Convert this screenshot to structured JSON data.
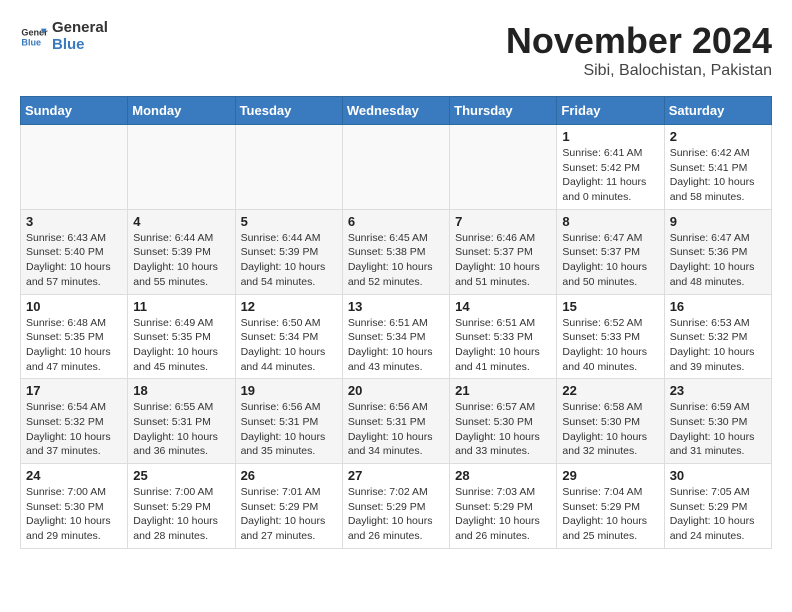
{
  "header": {
    "logo_general": "General",
    "logo_blue": "Blue",
    "month_title": "November 2024",
    "subtitle": "Sibi, Balochistan, Pakistan"
  },
  "weekdays": [
    "Sunday",
    "Monday",
    "Tuesday",
    "Wednesday",
    "Thursday",
    "Friday",
    "Saturday"
  ],
  "weeks": [
    [
      {
        "day": "",
        "info": ""
      },
      {
        "day": "",
        "info": ""
      },
      {
        "day": "",
        "info": ""
      },
      {
        "day": "",
        "info": ""
      },
      {
        "day": "",
        "info": ""
      },
      {
        "day": "1",
        "info": "Sunrise: 6:41 AM\nSunset: 5:42 PM\nDaylight: 11 hours and 0 minutes."
      },
      {
        "day": "2",
        "info": "Sunrise: 6:42 AM\nSunset: 5:41 PM\nDaylight: 10 hours and 58 minutes."
      }
    ],
    [
      {
        "day": "3",
        "info": "Sunrise: 6:43 AM\nSunset: 5:40 PM\nDaylight: 10 hours and 57 minutes."
      },
      {
        "day": "4",
        "info": "Sunrise: 6:44 AM\nSunset: 5:39 PM\nDaylight: 10 hours and 55 minutes."
      },
      {
        "day": "5",
        "info": "Sunrise: 6:44 AM\nSunset: 5:39 PM\nDaylight: 10 hours and 54 minutes."
      },
      {
        "day": "6",
        "info": "Sunrise: 6:45 AM\nSunset: 5:38 PM\nDaylight: 10 hours and 52 minutes."
      },
      {
        "day": "7",
        "info": "Sunrise: 6:46 AM\nSunset: 5:37 PM\nDaylight: 10 hours and 51 minutes."
      },
      {
        "day": "8",
        "info": "Sunrise: 6:47 AM\nSunset: 5:37 PM\nDaylight: 10 hours and 50 minutes."
      },
      {
        "day": "9",
        "info": "Sunrise: 6:47 AM\nSunset: 5:36 PM\nDaylight: 10 hours and 48 minutes."
      }
    ],
    [
      {
        "day": "10",
        "info": "Sunrise: 6:48 AM\nSunset: 5:35 PM\nDaylight: 10 hours and 47 minutes."
      },
      {
        "day": "11",
        "info": "Sunrise: 6:49 AM\nSunset: 5:35 PM\nDaylight: 10 hours and 45 minutes."
      },
      {
        "day": "12",
        "info": "Sunrise: 6:50 AM\nSunset: 5:34 PM\nDaylight: 10 hours and 44 minutes."
      },
      {
        "day": "13",
        "info": "Sunrise: 6:51 AM\nSunset: 5:34 PM\nDaylight: 10 hours and 43 minutes."
      },
      {
        "day": "14",
        "info": "Sunrise: 6:51 AM\nSunset: 5:33 PM\nDaylight: 10 hours and 41 minutes."
      },
      {
        "day": "15",
        "info": "Sunrise: 6:52 AM\nSunset: 5:33 PM\nDaylight: 10 hours and 40 minutes."
      },
      {
        "day": "16",
        "info": "Sunrise: 6:53 AM\nSunset: 5:32 PM\nDaylight: 10 hours and 39 minutes."
      }
    ],
    [
      {
        "day": "17",
        "info": "Sunrise: 6:54 AM\nSunset: 5:32 PM\nDaylight: 10 hours and 37 minutes."
      },
      {
        "day": "18",
        "info": "Sunrise: 6:55 AM\nSunset: 5:31 PM\nDaylight: 10 hours and 36 minutes."
      },
      {
        "day": "19",
        "info": "Sunrise: 6:56 AM\nSunset: 5:31 PM\nDaylight: 10 hours and 35 minutes."
      },
      {
        "day": "20",
        "info": "Sunrise: 6:56 AM\nSunset: 5:31 PM\nDaylight: 10 hours and 34 minutes."
      },
      {
        "day": "21",
        "info": "Sunrise: 6:57 AM\nSunset: 5:30 PM\nDaylight: 10 hours and 33 minutes."
      },
      {
        "day": "22",
        "info": "Sunrise: 6:58 AM\nSunset: 5:30 PM\nDaylight: 10 hours and 32 minutes."
      },
      {
        "day": "23",
        "info": "Sunrise: 6:59 AM\nSunset: 5:30 PM\nDaylight: 10 hours and 31 minutes."
      }
    ],
    [
      {
        "day": "24",
        "info": "Sunrise: 7:00 AM\nSunset: 5:30 PM\nDaylight: 10 hours and 29 minutes."
      },
      {
        "day": "25",
        "info": "Sunrise: 7:00 AM\nSunset: 5:29 PM\nDaylight: 10 hours and 28 minutes."
      },
      {
        "day": "26",
        "info": "Sunrise: 7:01 AM\nSunset: 5:29 PM\nDaylight: 10 hours and 27 minutes."
      },
      {
        "day": "27",
        "info": "Sunrise: 7:02 AM\nSunset: 5:29 PM\nDaylight: 10 hours and 26 minutes."
      },
      {
        "day": "28",
        "info": "Sunrise: 7:03 AM\nSunset: 5:29 PM\nDaylight: 10 hours and 26 minutes."
      },
      {
        "day": "29",
        "info": "Sunrise: 7:04 AM\nSunset: 5:29 PM\nDaylight: 10 hours and 25 minutes."
      },
      {
        "day": "30",
        "info": "Sunrise: 7:05 AM\nSunset: 5:29 PM\nDaylight: 10 hours and 24 minutes."
      }
    ]
  ]
}
